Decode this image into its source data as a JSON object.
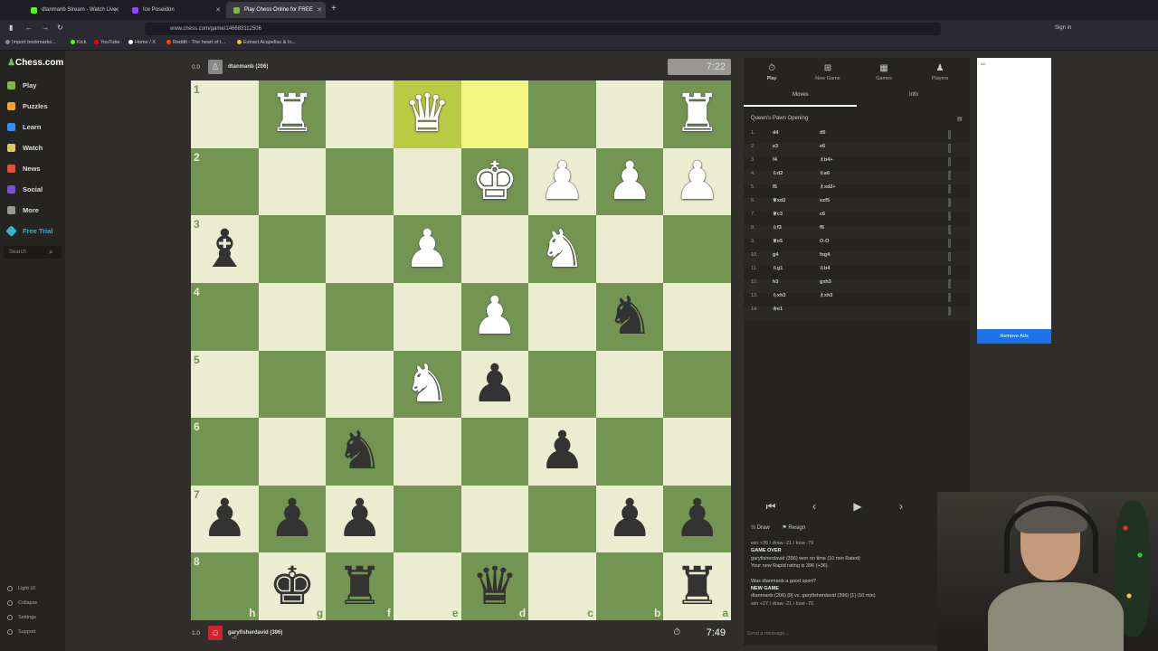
{
  "browser": {
    "tabs": [
      {
        "label": "dtanmanb Stream - Watch Live",
        "color": "#53fc18",
        "active": false
      },
      {
        "label": "Ice Poseidon",
        "color": "#9147ff",
        "active": false
      },
      {
        "label": "Play Chess Online for FREE",
        "color": "#81b64c",
        "active": true
      }
    ],
    "url": "www.chess.com/game/146683112506",
    "sign_in": "Sign in",
    "bookmarks": [
      {
        "label": "Import bookmarks...",
        "color": "#888"
      },
      {
        "label": "Kick",
        "color": "#53fc18"
      },
      {
        "label": "YouTube",
        "color": "#ff0000"
      },
      {
        "label": "Home / X",
        "color": "#fff"
      },
      {
        "label": "Reddit - The heart of t...",
        "color": "#ff4500"
      },
      {
        "label": "Extract Acapellas & In...",
        "color": "#f7c02b"
      }
    ]
  },
  "sidebar": {
    "logo": "Chess.com",
    "items": [
      {
        "label": "Play",
        "color": "#81b64c"
      },
      {
        "label": "Puzzles",
        "color": "#f7a133"
      },
      {
        "label": "Learn",
        "color": "#3692e7"
      },
      {
        "label": "Watch",
        "color": "#e3c75c"
      },
      {
        "label": "News",
        "color": "#e34f3c"
      },
      {
        "label": "Social",
        "color": "#7e4fd6"
      },
      {
        "label": "More",
        "color": "#999"
      },
      {
        "label": "Free Trial",
        "color": "#2fb6d0"
      }
    ],
    "search_placeholder": "Search",
    "footer": [
      "Light UI",
      "Collapse",
      "Settings",
      "Support"
    ]
  },
  "top_player": {
    "score": "0.0",
    "name": "dtanmanb (206)",
    "clock": "7:22"
  },
  "bottom_player": {
    "score": "1.0",
    "name": "garyfisherdavid (396)",
    "sub": "+5",
    "clock": "7:49"
  },
  "board": {
    "light": "#ebecd0",
    "dark": "#739552",
    "ranks": [
      "1",
      "2",
      "3",
      "4",
      "5",
      "6",
      "7",
      "8"
    ],
    "files": [
      "h",
      "g",
      "f",
      "e",
      "d",
      "c",
      "b",
      "a"
    ],
    "squares": [
      [
        "",
        "wR",
        "",
        "wQ",
        "",
        "",
        "",
        "wR"
      ],
      [
        "",
        "",
        "",
        "",
        "wK",
        "wP",
        "wP",
        "wP"
      ],
      [
        "bB",
        "",
        "",
        "wP",
        "",
        "wN",
        "",
        ""
      ],
      [
        "",
        "",
        "",
        "",
        "wP",
        "",
        "bN",
        ""
      ],
      [
        "",
        "",
        "",
        "wN",
        "bP",
        "",
        "",
        ""
      ],
      [
        "",
        "",
        "bN",
        "",
        "",
        "bP",
        "",
        ""
      ],
      [
        "bP",
        "bP",
        "bP",
        "",
        "",
        "",
        "bP",
        "bP"
      ],
      [
        "",
        "bK",
        "bR",
        "",
        "bQ",
        "",
        "",
        "bR"
      ]
    ],
    "highlights": [
      [
        0,
        3
      ],
      [
        0,
        4
      ]
    ]
  },
  "panel": {
    "tabs": [
      {
        "label": "Play",
        "icon": "⏱"
      },
      {
        "label": "New Game",
        "icon": "+"
      },
      {
        "label": "Games",
        "icon": "▦"
      },
      {
        "label": "Players",
        "icon": "👥"
      }
    ],
    "subtabs": [
      "Moves",
      "Info"
    ],
    "opening": "Queen's Pawn Opening",
    "moves": [
      {
        "n": "1.",
        "w": "d4",
        "b": "d5"
      },
      {
        "n": "2.",
        "w": "e3",
        "b": "e6"
      },
      {
        "n": "3.",
        "w": "f4",
        "b": "♗b4+"
      },
      {
        "n": "4.",
        "w": "♘d2",
        "b": "♘a6"
      },
      {
        "n": "5.",
        "w": "f5",
        "b": "♗xd2+"
      },
      {
        "n": "6.",
        "w": "♕xd2",
        "b": "exf5"
      },
      {
        "n": "7.",
        "w": "♕c3",
        "b": "c6"
      },
      {
        "n": "8.",
        "w": "♘f3",
        "b": "f6"
      },
      {
        "n": "9.",
        "w": "♕e5",
        "b": "O-O"
      },
      {
        "n": "10.",
        "w": "g4",
        "b": "fxg4"
      },
      {
        "n": "11.",
        "w": "♘g1",
        "b": "♘b4"
      },
      {
        "n": "12.",
        "w": "h3",
        "b": "gxh3"
      },
      {
        "n": "13.",
        "w": "♘xh3",
        "b": "♗xh3"
      },
      {
        "n": "14.",
        "w": "♔e1",
        "b": ""
      }
    ],
    "controls": [
      "⏮",
      "‹",
      "▶",
      "›"
    ],
    "draw": "Draw",
    "resign": "Resign",
    "chat": [
      {
        "text": "win +36 / draw -21 / lose -79",
        "style": "muted"
      },
      {
        "text": "GAME OVER",
        "style": "bold"
      },
      {
        "text": "garyfisherdavid (396) won on time (10 min Rated)",
        "style": ""
      },
      {
        "text": "Your new Rapid rating is 396 (+36).",
        "style": ""
      },
      {
        "text": "",
        "style": ""
      },
      {
        "text": "Was dtanmanb a good sport?",
        "style": ""
      },
      {
        "text": "NEW GAME",
        "style": "bold"
      },
      {
        "text": "dtanmanb (206) [0] vs. garyfisherdavid (396) [1] (10 min)",
        "style": ""
      },
      {
        "text": "win +27 / draw -21 / lose -76",
        "style": "muted"
      }
    ],
    "chat_placeholder": "Send a message..."
  },
  "ad": {
    "label": "AD",
    "remove": "Remove Ads"
  }
}
